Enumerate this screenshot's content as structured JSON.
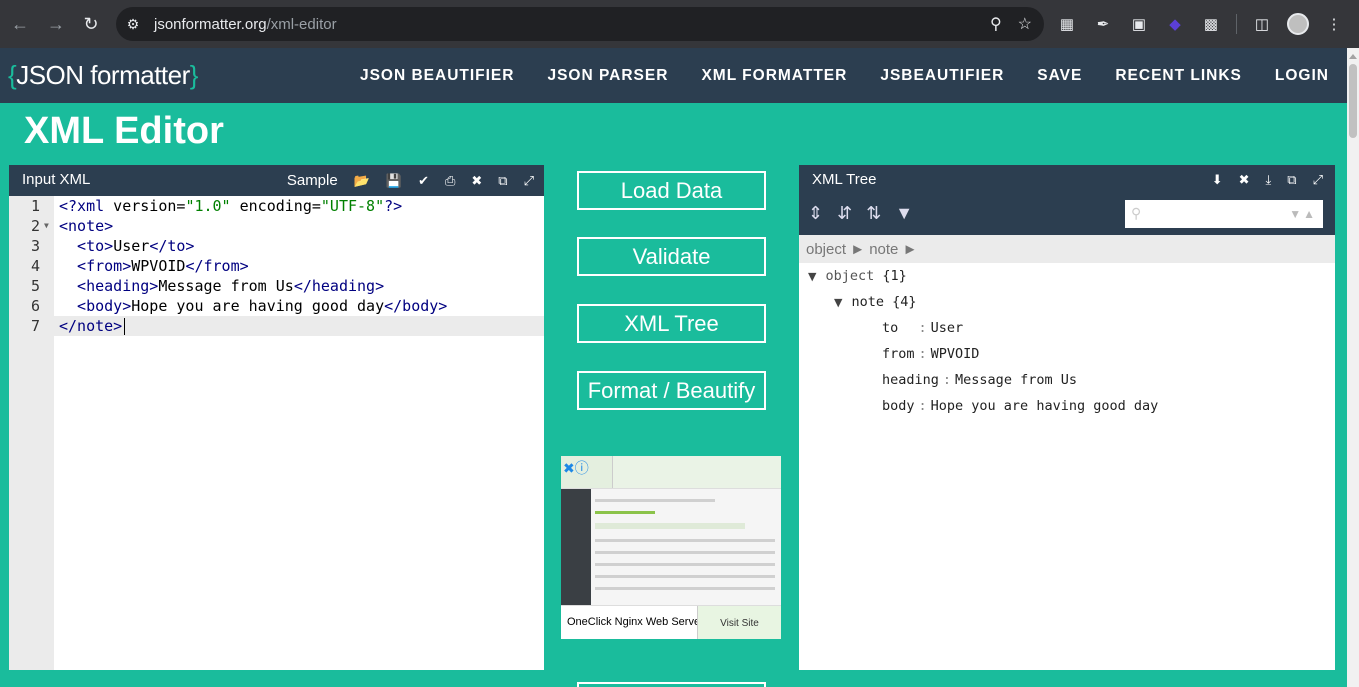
{
  "browser": {
    "url_domain": "jsonformatter.org",
    "url_path": "/xml-editor"
  },
  "site": {
    "logo_open": "{",
    "logo_text": "JSON formatter",
    "logo_close": "}",
    "nav": [
      "JSON BEAUTIFIER",
      "JSON PARSER",
      "XML FORMATTER",
      "JSBEAUTIFIER",
      "SAVE",
      "RECENT LINKS",
      "LOGIN"
    ]
  },
  "page": {
    "title": "XML Editor"
  },
  "input_panel": {
    "title": "Input XML",
    "sample_label": "Sample",
    "lines": [
      {
        "num": "1",
        "parts": [
          [
            "tag",
            "<?xml"
          ],
          [
            "attr",
            " version="
          ],
          [
            "val",
            "\"1.0\""
          ],
          [
            "attr",
            " encoding="
          ],
          [
            "val",
            "\"UTF-8\""
          ],
          [
            "tag",
            "?>"
          ]
        ]
      },
      {
        "num": "2",
        "parts": [
          [
            "tag",
            "<note>"
          ]
        ]
      },
      {
        "num": "3",
        "parts": [
          [
            "tag",
            "  <to>"
          ],
          [
            "attr",
            "User"
          ],
          [
            "tag",
            "</to>"
          ]
        ]
      },
      {
        "num": "4",
        "parts": [
          [
            "tag",
            "  <from>"
          ],
          [
            "attr",
            "WPVOID"
          ],
          [
            "tag",
            "</from>"
          ]
        ]
      },
      {
        "num": "5",
        "parts": [
          [
            "tag",
            "  <heading>"
          ],
          [
            "attr",
            "Message from Us"
          ],
          [
            "tag",
            "</heading>"
          ]
        ]
      },
      {
        "num": "6",
        "parts": [
          [
            "tag",
            "  <body>"
          ],
          [
            "attr",
            "Hope you are having good day"
          ],
          [
            "tag",
            "</body>"
          ]
        ]
      },
      {
        "num": "7",
        "parts": [
          [
            "tag",
            "</note>"
          ]
        ]
      }
    ]
  },
  "actions": {
    "load": "Load Data",
    "validate": "Validate",
    "tree": "XML Tree",
    "format": "Format / Beautify"
  },
  "ad": {
    "name": "OneClick Nginx Web Server",
    "visit": "Visit Site"
  },
  "tree_panel": {
    "title": "XML Tree",
    "breadcrumb": "object ► note ►",
    "root_key": "object",
    "root_count": "{1}",
    "note_key": "note",
    "note_count": "{4}",
    "fields": [
      {
        "key": "to",
        "pad": "  ",
        "value": "User"
      },
      {
        "key": "from",
        "pad": "",
        "value": "WPVOID"
      },
      {
        "key": "heading",
        "pad": "",
        "value": "Message from Us"
      },
      {
        "key": "body",
        "pad": "",
        "value": "Hope you are having good day"
      }
    ]
  }
}
